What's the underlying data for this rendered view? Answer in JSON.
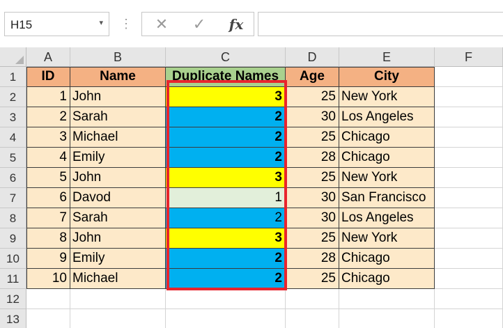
{
  "name_box": {
    "value": "H15",
    "dropdown_icon": "triangle-down"
  },
  "formula_bar": {
    "cancel_icon": "✕",
    "enter_icon": "✓",
    "fx_label": "fx",
    "formula": ""
  },
  "columns": [
    "A",
    "B",
    "C",
    "D",
    "E",
    "F"
  ],
  "rows": [
    "1",
    "2",
    "3",
    "4",
    "5",
    "6",
    "7",
    "8",
    "9",
    "10",
    "11",
    "12",
    "13"
  ],
  "table": {
    "headers": {
      "id": "ID",
      "name": "Name",
      "dup": "Duplicate Names",
      "age": "Age",
      "city": "City"
    },
    "records": [
      {
        "id": "1",
        "name": "John",
        "dup": "3",
        "age": "25",
        "city": "New York"
      },
      {
        "id": "2",
        "name": "Sarah",
        "dup": "2",
        "age": "30",
        "city": "Los Angeles"
      },
      {
        "id": "3",
        "name": "Michael",
        "dup": "2",
        "age": "25",
        "city": "Chicago"
      },
      {
        "id": "4",
        "name": "Emily",
        "dup": "2",
        "age": "28",
        "city": "Chicago"
      },
      {
        "id": "5",
        "name": "John",
        "dup": "3",
        "age": "25",
        "city": "New York"
      },
      {
        "id": "6",
        "name": "Davod",
        "dup": "1",
        "age": "30",
        "city": "San Francisco"
      },
      {
        "id": "7",
        "name": "Sarah",
        "dup": "2",
        "age": "30",
        "city": "Los Angeles"
      },
      {
        "id": "8",
        "name": "John",
        "dup": "3",
        "age": "25",
        "city": "New York"
      },
      {
        "id": "9",
        "name": "Emily",
        "dup": "2",
        "age": "28",
        "city": "Chicago"
      },
      {
        "id": "10",
        "name": "Michael",
        "dup": "2",
        "age": "25",
        "city": "Chicago"
      }
    ]
  },
  "colors": {
    "header_orange": "#f4b183",
    "header_green": "#a9d18e",
    "data_fill": "#fde9c9",
    "dup_3": "#ffff00",
    "dup_2": "#00b0f0",
    "dup_1": "#e2efda",
    "highlight_box": "#e8252d"
  }
}
